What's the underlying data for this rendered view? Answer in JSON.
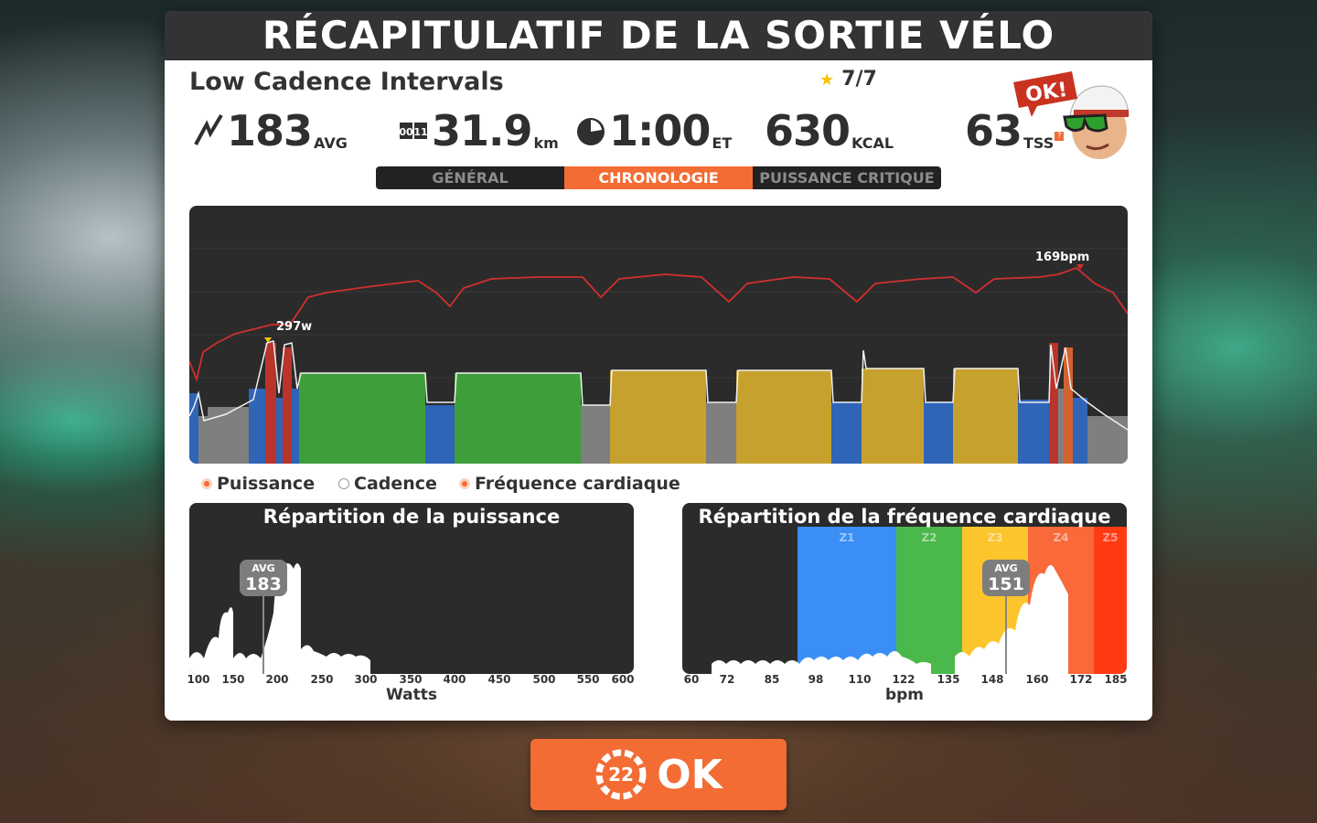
{
  "title": "RÉCAPITULATIF DE LA SORTIE VÉLO",
  "workout": {
    "name": "Low Cadence Intervals",
    "rating": "7/7"
  },
  "stats": [
    {
      "icon": "power-icon",
      "value": "183",
      "unit": "AVG"
    },
    {
      "icon": "odometer-icon",
      "value": "31.9",
      "unit": "km"
    },
    {
      "icon": "clock-icon",
      "value": "1:00",
      "unit": "ET"
    },
    {
      "icon": "",
      "value": "630",
      "unit": "KCAL"
    },
    {
      "icon": "",
      "value": "63",
      "unit": "TSS",
      "help": "?"
    }
  ],
  "avatar": {
    "speech": "OK!"
  },
  "tabs": [
    {
      "label": "GÉNÉRAL",
      "active": false
    },
    {
      "label": "CHRONOLOGIE",
      "active": true
    },
    {
      "label": "PUISSANCE CRITIQUE",
      "active": false
    }
  ],
  "timeline": {
    "power_peak_label": "297w",
    "hr_peak_label": "169bpm",
    "zone_colors": {
      "z1": "#7f7f7f",
      "z2": "#2f64b7",
      "z3": "#3e9f3a",
      "z4": "#c6a12e",
      "z5": "#d4622e",
      "z6": "#b9342a"
    },
    "hr_color": "#d12f2f"
  },
  "legend": [
    {
      "label": "Puissance",
      "on": true
    },
    {
      "label": "Cadence",
      "on": false
    },
    {
      "label": "Fréquence cardiaque",
      "on": true
    }
  ],
  "power_dist": {
    "title": "Répartition de la puissance",
    "avg_label": "AVG",
    "avg_value": "183",
    "ticks": [
      "100",
      "150",
      "200",
      "250",
      "300",
      "350",
      "400",
      "450",
      "500",
      "550",
      "600"
    ],
    "xlabel": "Watts"
  },
  "hr_dist": {
    "title": "Répartition de la fréquence cardiaque",
    "avg_label": "AVG",
    "avg_value": "151",
    "zones": [
      "Z1",
      "Z2",
      "Z3",
      "Z4",
      "Z5"
    ],
    "zone_colors": [
      "#3a8ef6",
      "#4ab84a",
      "#fcc52c",
      "#f9693a",
      "#ff3b14"
    ],
    "ticks": [
      "60",
      "72",
      "85",
      "98",
      "110",
      "122",
      "135",
      "148",
      "160",
      "172",
      "185"
    ],
    "xlabel": "bpm"
  },
  "ok_button": {
    "badge": "22",
    "label": "OK"
  }
}
